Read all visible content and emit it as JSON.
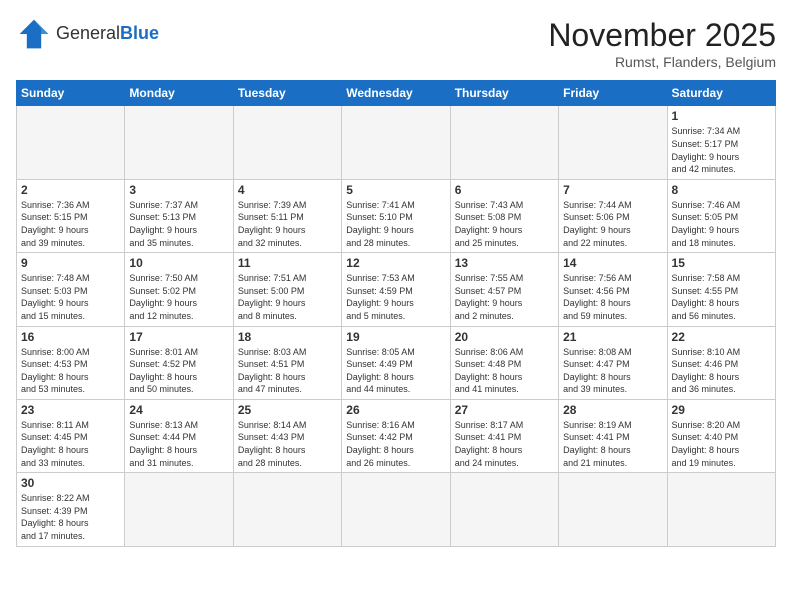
{
  "logo": {
    "general": "General",
    "blue": "Blue"
  },
  "title": "November 2025",
  "location": "Rumst, Flanders, Belgium",
  "weekdays": [
    "Sunday",
    "Monday",
    "Tuesday",
    "Wednesday",
    "Thursday",
    "Friday",
    "Saturday"
  ],
  "days": [
    {
      "date": "",
      "info": ""
    },
    {
      "date": "",
      "info": ""
    },
    {
      "date": "",
      "info": ""
    },
    {
      "date": "",
      "info": ""
    },
    {
      "date": "",
      "info": ""
    },
    {
      "date": "",
      "info": ""
    },
    {
      "date": "1",
      "info": "Sunrise: 7:34 AM\nSunset: 5:17 PM\nDaylight: 9 hours\nand 42 minutes."
    },
    {
      "date": "2",
      "info": "Sunrise: 7:36 AM\nSunset: 5:15 PM\nDaylight: 9 hours\nand 39 minutes."
    },
    {
      "date": "3",
      "info": "Sunrise: 7:37 AM\nSunset: 5:13 PM\nDaylight: 9 hours\nand 35 minutes."
    },
    {
      "date": "4",
      "info": "Sunrise: 7:39 AM\nSunset: 5:11 PM\nDaylight: 9 hours\nand 32 minutes."
    },
    {
      "date": "5",
      "info": "Sunrise: 7:41 AM\nSunset: 5:10 PM\nDaylight: 9 hours\nand 28 minutes."
    },
    {
      "date": "6",
      "info": "Sunrise: 7:43 AM\nSunset: 5:08 PM\nDaylight: 9 hours\nand 25 minutes."
    },
    {
      "date": "7",
      "info": "Sunrise: 7:44 AM\nSunset: 5:06 PM\nDaylight: 9 hours\nand 22 minutes."
    },
    {
      "date": "8",
      "info": "Sunrise: 7:46 AM\nSunset: 5:05 PM\nDaylight: 9 hours\nand 18 minutes."
    },
    {
      "date": "9",
      "info": "Sunrise: 7:48 AM\nSunset: 5:03 PM\nDaylight: 9 hours\nand 15 minutes."
    },
    {
      "date": "10",
      "info": "Sunrise: 7:50 AM\nSunset: 5:02 PM\nDaylight: 9 hours\nand 12 minutes."
    },
    {
      "date": "11",
      "info": "Sunrise: 7:51 AM\nSunset: 5:00 PM\nDaylight: 9 hours\nand 8 minutes."
    },
    {
      "date": "12",
      "info": "Sunrise: 7:53 AM\nSunset: 4:59 PM\nDaylight: 9 hours\nand 5 minutes."
    },
    {
      "date": "13",
      "info": "Sunrise: 7:55 AM\nSunset: 4:57 PM\nDaylight: 9 hours\nand 2 minutes."
    },
    {
      "date": "14",
      "info": "Sunrise: 7:56 AM\nSunset: 4:56 PM\nDaylight: 8 hours\nand 59 minutes."
    },
    {
      "date": "15",
      "info": "Sunrise: 7:58 AM\nSunset: 4:55 PM\nDaylight: 8 hours\nand 56 minutes."
    },
    {
      "date": "16",
      "info": "Sunrise: 8:00 AM\nSunset: 4:53 PM\nDaylight: 8 hours\nand 53 minutes."
    },
    {
      "date": "17",
      "info": "Sunrise: 8:01 AM\nSunset: 4:52 PM\nDaylight: 8 hours\nand 50 minutes."
    },
    {
      "date": "18",
      "info": "Sunrise: 8:03 AM\nSunset: 4:51 PM\nDaylight: 8 hours\nand 47 minutes."
    },
    {
      "date": "19",
      "info": "Sunrise: 8:05 AM\nSunset: 4:49 PM\nDaylight: 8 hours\nand 44 minutes."
    },
    {
      "date": "20",
      "info": "Sunrise: 8:06 AM\nSunset: 4:48 PM\nDaylight: 8 hours\nand 41 minutes."
    },
    {
      "date": "21",
      "info": "Sunrise: 8:08 AM\nSunset: 4:47 PM\nDaylight: 8 hours\nand 39 minutes."
    },
    {
      "date": "22",
      "info": "Sunrise: 8:10 AM\nSunset: 4:46 PM\nDaylight: 8 hours\nand 36 minutes."
    },
    {
      "date": "23",
      "info": "Sunrise: 8:11 AM\nSunset: 4:45 PM\nDaylight: 8 hours\nand 33 minutes."
    },
    {
      "date": "24",
      "info": "Sunrise: 8:13 AM\nSunset: 4:44 PM\nDaylight: 8 hours\nand 31 minutes."
    },
    {
      "date": "25",
      "info": "Sunrise: 8:14 AM\nSunset: 4:43 PM\nDaylight: 8 hours\nand 28 minutes."
    },
    {
      "date": "26",
      "info": "Sunrise: 8:16 AM\nSunset: 4:42 PM\nDaylight: 8 hours\nand 26 minutes."
    },
    {
      "date": "27",
      "info": "Sunrise: 8:17 AM\nSunset: 4:41 PM\nDaylight: 8 hours\nand 24 minutes."
    },
    {
      "date": "28",
      "info": "Sunrise: 8:19 AM\nSunset: 4:41 PM\nDaylight: 8 hours\nand 21 minutes."
    },
    {
      "date": "29",
      "info": "Sunrise: 8:20 AM\nSunset: 4:40 PM\nDaylight: 8 hours\nand 19 minutes."
    },
    {
      "date": "30",
      "info": "Sunrise: 8:22 AM\nSunset: 4:39 PM\nDaylight: 8 hours\nand 17 minutes."
    },
    {
      "date": "",
      "info": ""
    },
    {
      "date": "",
      "info": ""
    },
    {
      "date": "",
      "info": ""
    },
    {
      "date": "",
      "info": ""
    },
    {
      "date": "",
      "info": ""
    },
    {
      "date": "",
      "info": ""
    }
  ]
}
